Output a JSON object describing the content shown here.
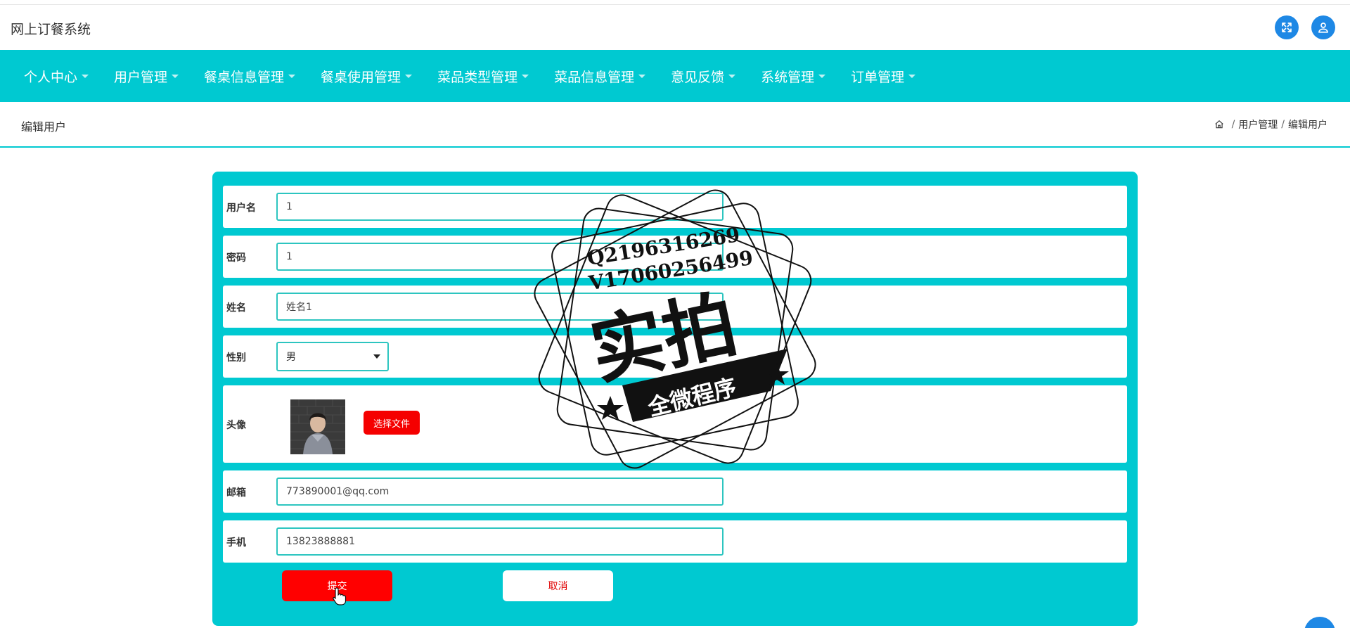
{
  "header": {
    "app_title": "网上订餐系统",
    "fullscreen_icon": "expand-icon",
    "user_icon": "user-icon"
  },
  "nav": {
    "items": [
      {
        "label": "个人中心"
      },
      {
        "label": "用户管理"
      },
      {
        "label": "餐桌信息管理"
      },
      {
        "label": "餐桌使用管理"
      },
      {
        "label": "菜品类型管理"
      },
      {
        "label": "菜品信息管理"
      },
      {
        "label": "意见反馈"
      },
      {
        "label": "系统管理"
      },
      {
        "label": "订单管理"
      }
    ]
  },
  "page": {
    "title": "编辑用户",
    "breadcrumb": [
      "用户管理",
      "编辑用户"
    ]
  },
  "form": {
    "username": {
      "label": "用户名",
      "value": "1"
    },
    "password": {
      "label": "密码",
      "value": "1"
    },
    "name": {
      "label": "姓名",
      "value": "姓名1"
    },
    "gender": {
      "label": "性别",
      "value": "男"
    },
    "avatar": {
      "label": "头像",
      "button": "选择文件"
    },
    "email": {
      "label": "邮箱",
      "value": "773890001@qq.com"
    },
    "phone": {
      "label": "手机",
      "value": "13823888881"
    },
    "submit_label": "提交",
    "cancel_label": "取消"
  },
  "watermark": {
    "line1": "Q2196316269",
    "line2": "V17060256499",
    "main": "实拍",
    "banner": "全微程序"
  },
  "colors": {
    "accent": "#00c9d1",
    "primary_button": "#ff0000",
    "icon_button": "#1e88e5"
  }
}
